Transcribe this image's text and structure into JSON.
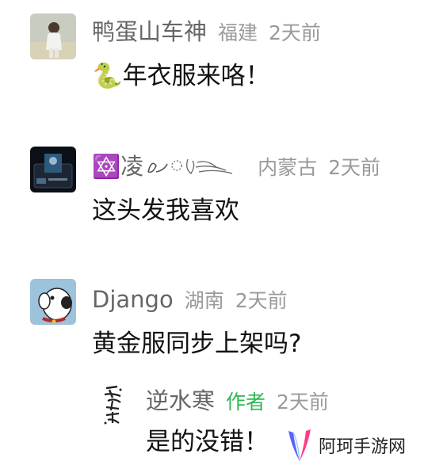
{
  "comments": [
    {
      "username": "鸭蛋山车神",
      "location": "福建",
      "time": "2天前",
      "content_emoji": "🐍",
      "content": "年衣服来咯！"
    },
    {
      "username_emoji": "🔯",
      "username": "凌",
      "location": "内蒙古",
      "time": "2天前",
      "content": "这头发我喜欢"
    },
    {
      "username": "Django",
      "location": "湖南",
      "time": "2天前",
      "content": "黄金服同步上架吗?"
    }
  ],
  "reply": {
    "username": "逆水寒",
    "badge": "作者",
    "time": "2天前",
    "content": "是的没错！"
  },
  "watermark": {
    "text": "阿珂手游网"
  },
  "colors": {
    "username": "#666666",
    "meta": "#9a9a9a",
    "author_badge": "#2db84d",
    "content": "#111111"
  }
}
